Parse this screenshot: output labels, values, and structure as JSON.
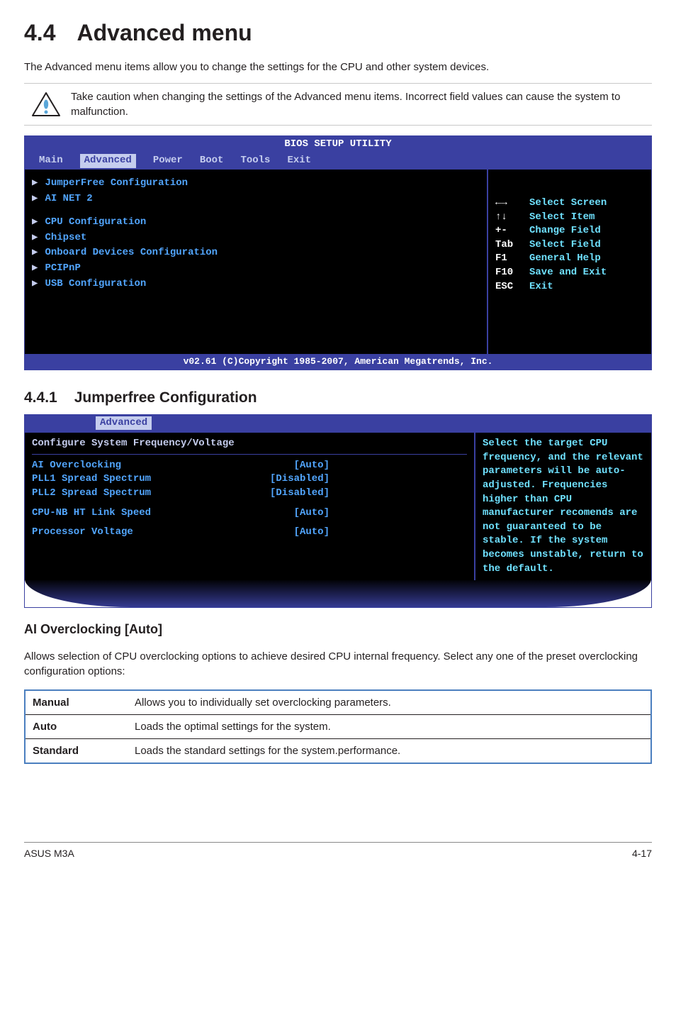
{
  "page": {
    "section_number": "4.4",
    "section_title": "Advanced menu",
    "intro": "The Advanced menu items allow you to change the settings for the CPU and other system devices.",
    "caution": "Take caution when changing the settings of the Advanced menu items. Incorrect field values can cause the system to malfunction."
  },
  "bios1": {
    "header": "BIOS SETUP UTILITY",
    "tabs": [
      "Main",
      "Advanced",
      "Power",
      "Boot",
      "Tools",
      "Exit"
    ],
    "selected_tab": "Advanced",
    "menu_group1": [
      "JumperFree Configuration",
      "AI NET 2"
    ],
    "menu_group2": [
      "CPU Configuration",
      "Chipset",
      "Onboard Devices Configuration",
      "PCIPnP",
      "USB Configuration"
    ],
    "keys": [
      {
        "k": "←→",
        "d": "Select Screen"
      },
      {
        "k": "↑↓",
        "d": "Select Item"
      },
      {
        "k": "+-",
        "d": "Change Field"
      },
      {
        "k": "Tab",
        "d": "Select Field"
      },
      {
        "k": "F1",
        "d": "General Help"
      },
      {
        "k": "F10",
        "d": "Save and Exit"
      },
      {
        "k": "ESC",
        "d": "Exit"
      }
    ],
    "footer": "v02.61 (C)Copyright 1985-2007, American Megatrends, Inc."
  },
  "sub": {
    "number": "4.4.1",
    "title": "Jumperfree Configuration"
  },
  "bios2": {
    "tab": "Advanced",
    "title": "Configure System Frequency/Voltage",
    "rows": [
      {
        "label": "AI Overclocking",
        "value": "[Auto]"
      },
      {
        "label": "PLL1 Spread Spectrum",
        "value": "[Disabled]"
      },
      {
        "label": "PLL2 Spread Spectrum",
        "value": "[Disabled]"
      },
      {
        "label": "CPU-NB HT Link Speed",
        "value": "[Auto]"
      },
      {
        "label": "Processor Voltage",
        "value": "[Auto]"
      }
    ],
    "help": "Select the target CPU frequency, and the relevant parameters will be auto-adjusted. Frequencies higher than CPU manufacturer recomends are not guaranteed to be stable. If the system becomes unstable, return to the default."
  },
  "ai": {
    "heading": "AI Overclocking [Auto]",
    "text": "Allows selection of CPU overclocking options to achieve desired CPU internal frequency. Select any one of the preset overclocking configuration options:",
    "opts": [
      {
        "name": "Manual",
        "desc": "Allows you to individually set overclocking parameters."
      },
      {
        "name": "Auto",
        "desc": "Loads the optimal settings for the system."
      },
      {
        "name": "Standard",
        "desc": "Loads the standard settings for the system.performance."
      }
    ]
  },
  "footer": {
    "model": "ASUS M3A",
    "page": "4-17"
  }
}
